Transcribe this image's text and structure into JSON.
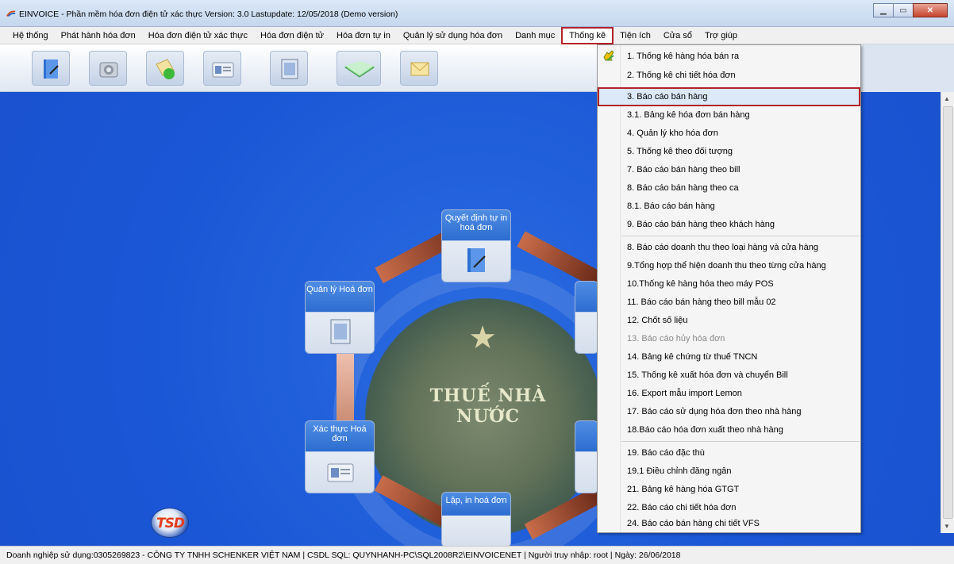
{
  "window": {
    "title": "EINVOICE - Phần mềm hóa đơn điện tử xác thực Version: 3.0 Lastupdate: 12/05/2018 (Demo version)",
    "minimize": "▁",
    "maximize": "▭",
    "close": "✕"
  },
  "menu": [
    {
      "label": "Hệ thống"
    },
    {
      "label": "Phát hành hóa đơn"
    },
    {
      "label": "Hóa đơn điện tử xác thực"
    },
    {
      "label": "Hóa đơn điện tử"
    },
    {
      "label": "Hóa đơn tự in"
    },
    {
      "label": "Quản lý sử dụng hóa đơn"
    },
    {
      "label": "Danh mục"
    },
    {
      "label": "Thống kê"
    },
    {
      "label": "Tiện ích"
    },
    {
      "label": "Cửa sổ"
    },
    {
      "label": "Trợ giúp"
    }
  ],
  "dropdown": [
    {
      "label": "1. Thống kê hàng hóa bán ra"
    },
    {
      "label": "2. Thống kê chi tiết hóa đơn"
    },
    {
      "label": "3. Báo cáo bán hàng"
    },
    {
      "label": "3.1. Bảng kê hóa đơn bán hàng"
    },
    {
      "label": "4. Quản lý kho hóa đơn"
    },
    {
      "label": "5. Thống kê theo đối tượng"
    },
    {
      "label": "7. Báo cáo bán hàng theo bill"
    },
    {
      "label": "8. Báo cáo bán hàng theo ca"
    },
    {
      "label": "8.1. Báo cáo bán hàng"
    },
    {
      "label": "9. Báo cáo bán hàng theo khách hàng"
    },
    {
      "label": "8. Báo cáo doanh thu theo loại hàng và cửa hàng"
    },
    {
      "label": "9.Tổng hợp thể hiện doanh thu theo từng cửa hàng"
    },
    {
      "label": "10.Thống kê hàng hóa theo máy POS"
    },
    {
      "label": "11. Báo cáo bán hàng theo bill mẫu 02"
    },
    {
      "label": "12. Chốt số liệu"
    },
    {
      "label": "13. Báo cáo hủy hóa đơn"
    },
    {
      "label": "14. Bảng kê chứng từ thuế TNCN"
    },
    {
      "label": "15. Thống kê xuất hóa đơn và chuyển Bill"
    },
    {
      "label": "16. Export mẫu import Lemon"
    },
    {
      "label": "17. Báo cáo sử dụng hóa đơn theo nhà hàng"
    },
    {
      "label": "18.Báo cáo hóa đơn xuất theo nhà hàng"
    },
    {
      "label": "19. Báo cáo đặc thù"
    },
    {
      "label": "19.1 Điều chỉnh đăng ngân"
    },
    {
      "label": "21. Bảng kê hàng hóa GTGT"
    },
    {
      "label": "22. Báo cáo chi tiết hóa đơn"
    },
    {
      "label": "24. Báo cáo bán hàng chi tiết VFS"
    }
  ],
  "workflow": {
    "node_decide": "Quyết định tự in hoá đơn",
    "node_manage": "Quản lý Hoá đơn",
    "node_verify": "Xác thực Hoá đơn",
    "node_create": "Lập, in hoá đơn",
    "seal_text": "THUẾ NHÀ NƯỚC",
    "logo_text": "TSD"
  },
  "statusbar": {
    "text": "Doanh nghiệp sử dụng:0305269823 - CÔNG TY TNHH SCHENKER VIỆT NAM  |  CSDL SQL: QUYNHANH-PC\\SQL2008R2\\EINVOICENET  |  Người truy nhập: root  |  Ngày: 26/06/2018"
  }
}
